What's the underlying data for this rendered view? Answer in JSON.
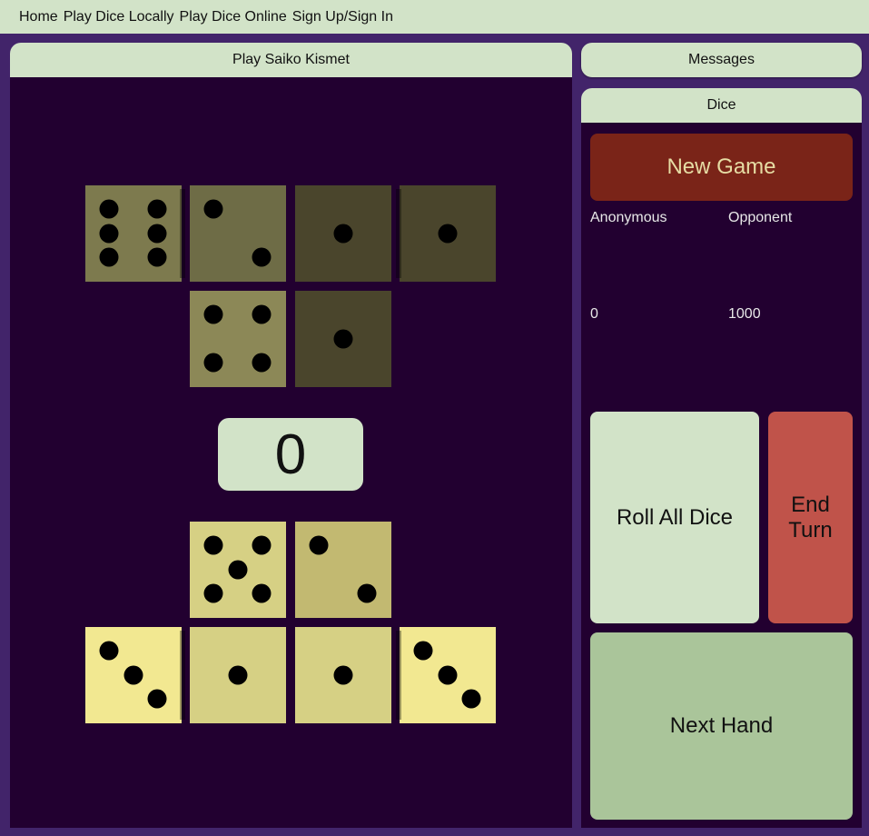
{
  "nav": {
    "home": "Home",
    "play_local": "Play Dice Locally",
    "play_online": "Play Dice Online",
    "signin": "Sign Up/Sign In"
  },
  "game": {
    "title": "Play Saiko Kismet",
    "score": "0"
  },
  "messages": {
    "title": "Messages"
  },
  "dice_panel": {
    "title": "Dice",
    "new_game": "New Game",
    "players": [
      {
        "name": "Anonymous",
        "score": "0"
      },
      {
        "name": "Opponent",
        "score": "1000"
      }
    ],
    "roll_all": "Roll All Dice",
    "end_turn": "End Turn",
    "next_hand": "Next Hand"
  },
  "dice": {
    "opponent": [
      6,
      2,
      1,
      1,
      4,
      1
    ],
    "player": [
      5,
      2,
      3,
      1,
      1,
      3
    ]
  },
  "colors": {
    "nav_bg": "#d2e3c8",
    "page_bg": "#42246a",
    "board_bg": "#220030",
    "new_game_bg": "#7a2418",
    "end_turn_bg": "#c0534a",
    "next_hand_bg": "#aac59a",
    "die_opp_a": "#7d7a4e",
    "die_opp_b": "#6e6c46",
    "die_opp_dark": "#4a452c",
    "die_opp_light": "#8c8857",
    "die_player_a": "#d6d084",
    "die_player_b": "#c2b971",
    "die_player_c": "#f2e891"
  }
}
